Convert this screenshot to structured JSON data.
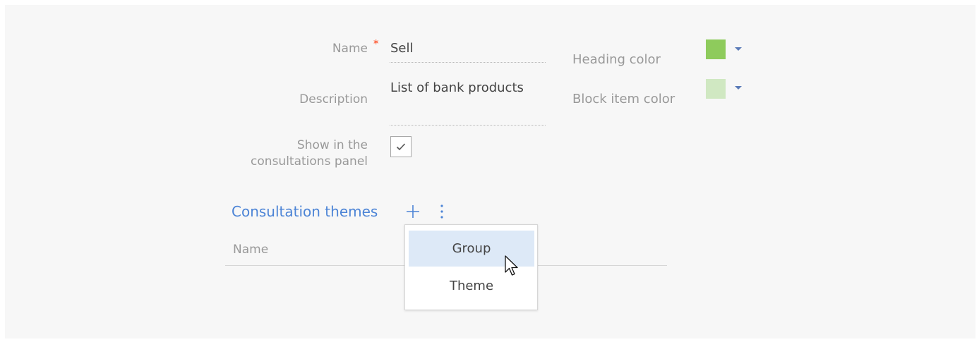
{
  "form": {
    "name": {
      "label": "Name",
      "required_mark": "*",
      "value": "Sell"
    },
    "description": {
      "label": "Description",
      "value": "List of bank products"
    },
    "show_in_panel": {
      "label_line1": "Show in the",
      "label_line2": "consultations panel",
      "checked": true
    },
    "heading_color": {
      "label": "Heading color",
      "color": "#8ecb5c"
    },
    "block_item_color": {
      "label": "Block item color",
      "color": "#d0e8c2"
    }
  },
  "consultation_themes": {
    "title": "Consultation themes",
    "add_icon": "plus-icon",
    "more_icon": "kebab-icon",
    "columns": [
      "Name"
    ]
  },
  "add_menu": {
    "items": [
      {
        "label": "Group",
        "active": true
      },
      {
        "label": "Theme",
        "active": false
      }
    ]
  },
  "colors": {
    "accent": "#4c84d6",
    "required": "#ff4013",
    "caret": "#5b7bb8",
    "menu_highlight": "#dde9f7"
  }
}
